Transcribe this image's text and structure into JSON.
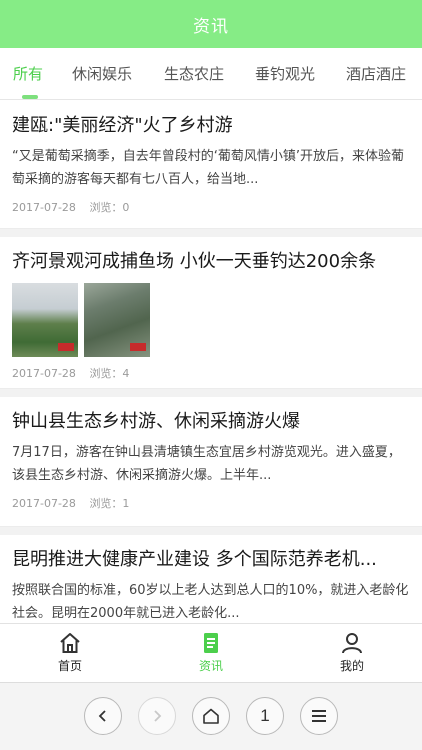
{
  "header": {
    "title": "资讯"
  },
  "tabs": [
    {
      "label": "所有",
      "active": true
    },
    {
      "label": "休闲娱乐",
      "active": false
    },
    {
      "label": "生态农庄",
      "active": false
    },
    {
      "label": "垂钓观光",
      "active": false
    },
    {
      "label": "酒店酒庄",
      "active": false
    }
  ],
  "articles": [
    {
      "title": "建瓯:\"美丽经济\"火了乡村游",
      "summary": "“又是葡萄采摘季，自去年曾段村的‘葡萄风情小镇’开放后，来体验葡萄采摘的游客每天都有七八百人，给当地...",
      "date": "2017-07-28",
      "views": "浏览：0"
    },
    {
      "title": "齐河景观河成捕鱼场 小伙一天垂钓达200余条",
      "date": "2017-07-28",
      "views": "浏览：4"
    },
    {
      "title": "钟山县生态乡村游、休闲采摘游火爆",
      "summary": "7月17日，游客在钟山县清塘镇生态宜居乡村游览观光。进入盛夏，该县生态乡村游、休闲采摘游火爆。上半年...",
      "date": "2017-07-28",
      "views": "浏览：1"
    },
    {
      "title": "昆明推进大健康产业建设 多个国际范养老机...",
      "summary": "按照联合国的标准，60岁以上老人达到总人口的10%，就进入老龄化社会。昆明在2000年就已进入老龄化..."
    }
  ],
  "bottom_nav": [
    {
      "label": "首页",
      "icon": "home-icon",
      "active": false
    },
    {
      "label": "资讯",
      "icon": "news-icon",
      "active": true
    },
    {
      "label": "我的",
      "icon": "user-icon",
      "active": false
    }
  ],
  "browser_bar": {
    "page_count": "1"
  },
  "colors": {
    "accent": "#86ec86",
    "active_text": "#4ccf4c"
  }
}
